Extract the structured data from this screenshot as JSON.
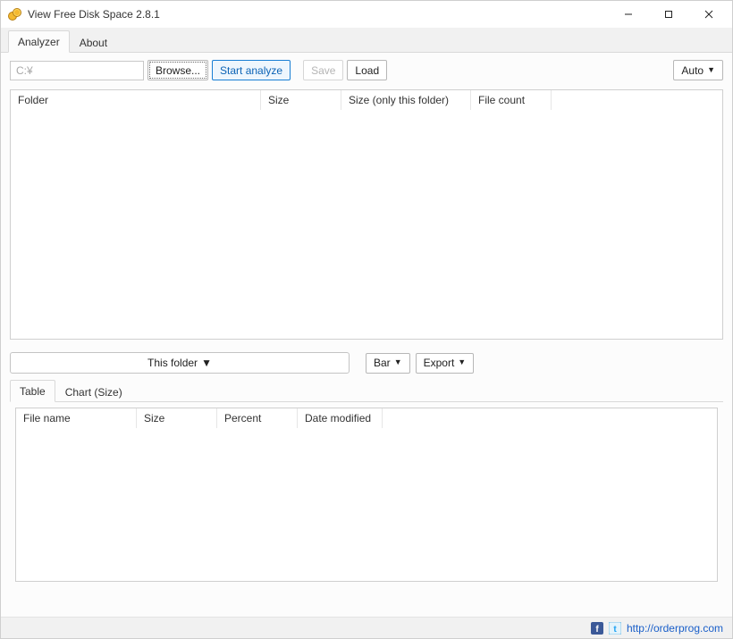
{
  "window": {
    "title": "View Free Disk Space 2.8.1"
  },
  "tabs": {
    "analyzer": "Analyzer",
    "about": "About"
  },
  "path": {
    "value": "C:¥"
  },
  "buttons": {
    "browse": "Browse...",
    "start": "Start analyze",
    "save": "Save",
    "load": "Load",
    "auto": "Auto"
  },
  "topcols": {
    "folder": "Folder",
    "size": "Size",
    "size_only": "Size (only this folder)",
    "file_count": "File count"
  },
  "mid": {
    "this_folder": "This folder",
    "bar": "Bar",
    "export": "Export"
  },
  "subtabs": {
    "table": "Table",
    "chart": "Chart (Size)"
  },
  "lowcols": {
    "file_name": "File name",
    "size": "Size",
    "percent": "Percent",
    "date_modified": "Date modified"
  },
  "footer": {
    "url": "http://orderprog.com"
  }
}
